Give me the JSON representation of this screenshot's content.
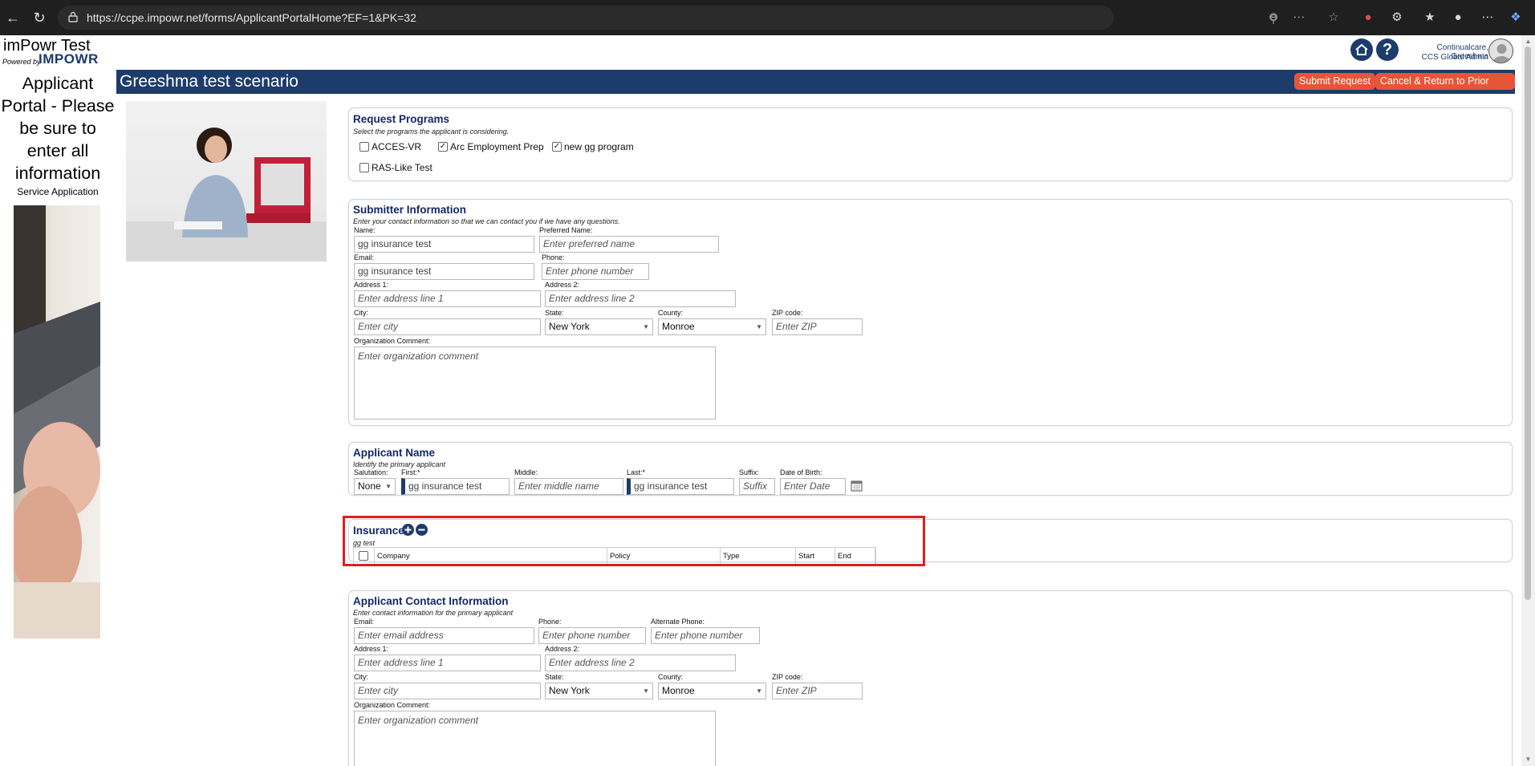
{
  "browser": {
    "url": "https://ccpe.impowr.net/forms/ApplicantPortalHome?EF=1&PK=32"
  },
  "left": {
    "site_title": "imPowr Test",
    "powered_by": "Powered by",
    "brand": "IMPOWR",
    "portal_heading": "Applicant Portal - Please be sure to enter all information",
    "service_application": "Service Application"
  },
  "header": {
    "form_title": "Greeshma test scenario",
    "submit_label": "Submit Request",
    "cancel_label": "Cancel & Return to Prior Page"
  },
  "user": {
    "name": "Continualcare, Greeshma",
    "role": "CCS Global Admin"
  },
  "request_programs": {
    "title": "Request Programs",
    "subtitle": "Select the programs the applicant is considering.",
    "options": [
      {
        "label": "ACCES-VR",
        "checked": false
      },
      {
        "label": "Arc Employment Prep",
        "checked": true
      },
      {
        "label": "new gg program",
        "checked": true
      },
      {
        "label": "RAS-Like Test",
        "checked": false
      }
    ]
  },
  "submitter": {
    "title": "Submitter Information",
    "subtitle": "Enter your contact information so that we can contact you if we have any questions.",
    "name_label": "Name:",
    "name_value": "gg insurance test",
    "preferred_label": "Preferred Name:",
    "preferred_ph": "Enter preferred name",
    "email_label": "Email:",
    "email_value": "gg insurance test",
    "phone_label": "Phone:",
    "phone_ph": "Enter phone number",
    "address1_label": "Address 1:",
    "address1_ph": "Enter address line 1",
    "address2_label": "Address 2:",
    "address2_ph": "Enter address line 2",
    "city_label": "City:",
    "city_ph": "Enter city",
    "state_label": "State:",
    "state_value": "New York",
    "county_label": "County:",
    "county_value": "Monroe",
    "zip_label": "ZIP code:",
    "zip_ph": "Enter ZIP",
    "comment_label": "Organization Comment:",
    "comment_ph": "Enter organization comment"
  },
  "applicant_name": {
    "title": "Applicant Name",
    "subtitle": "Identify the primary applicant",
    "salutation_label": "Salutation:",
    "salutation_value": "None",
    "first_label": "First:*",
    "first_value": "gg insurance test",
    "middle_label": "Middle:",
    "middle_ph": "Enter middle name",
    "last_label": "Last:*",
    "last_value": "gg insurance test",
    "suffix_label": "Suffix:",
    "suffix_ph": "Suffix",
    "dob_label": "Date of Birth:",
    "dob_ph": "Enter Date"
  },
  "insurance": {
    "title": "Insurance",
    "subtitle": "gg test",
    "columns": [
      "Company",
      "Policy",
      "Type",
      "Start",
      "End"
    ]
  },
  "contact": {
    "title": "Applicant Contact Information",
    "subtitle": "Enter contact information for the primary applicant",
    "email_label": "Email:",
    "email_ph": "Enter email address",
    "phone_label": "Phone:",
    "phone_ph": "Enter phone number",
    "alt_phone_label": "Alternate Phone:",
    "alt_phone_ph": "Enter phone number",
    "address1_label": "Address 1:",
    "address1_ph": "Enter address line 1",
    "address2_label": "Address 2:",
    "address2_ph": "Enter address line 2",
    "city_label": "City:",
    "city_ph": "Enter city",
    "state_label": "State:",
    "state_value": "New York",
    "county_label": "County:",
    "county_value": "Monroe",
    "zip_label": "ZIP code:",
    "zip_ph": "Enter ZIP",
    "comment_label": "Organization Comment:",
    "comment_ph": "Enter organization comment"
  },
  "colors": {
    "header_bg": "#1d3c6b",
    "button_bg": "#e8543a",
    "section_title": "#14276b",
    "highlight": "#e11d1d"
  }
}
